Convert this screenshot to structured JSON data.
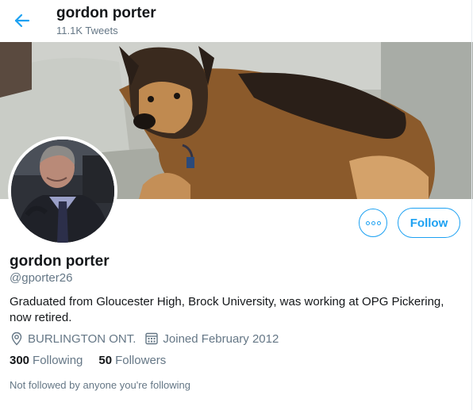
{
  "header": {
    "name": "gordon porter",
    "tweet_count": "11.1K Tweets"
  },
  "profile": {
    "name": "gordon porter",
    "handle": "@gporter26",
    "bio": "Graduated from Gloucester High, Brock University, was working at OPG Pickering, now retired.",
    "location": "BURLINGTON ONT.",
    "joined": "Joined February 2012",
    "following_count": "300",
    "following_label": "Following",
    "followers_count": "50",
    "followers_label": "Followers",
    "followed_by_note": "Not followed by anyone you're following"
  },
  "actions": {
    "follow_label": "Follow"
  },
  "icons": {
    "back": "arrow-left-icon",
    "more": "more-options-icon",
    "location": "location-pin-icon",
    "calendar": "calendar-icon"
  },
  "colors": {
    "accent": "#1da1f2",
    "text_primary": "#14171a",
    "text_secondary": "#657786"
  }
}
